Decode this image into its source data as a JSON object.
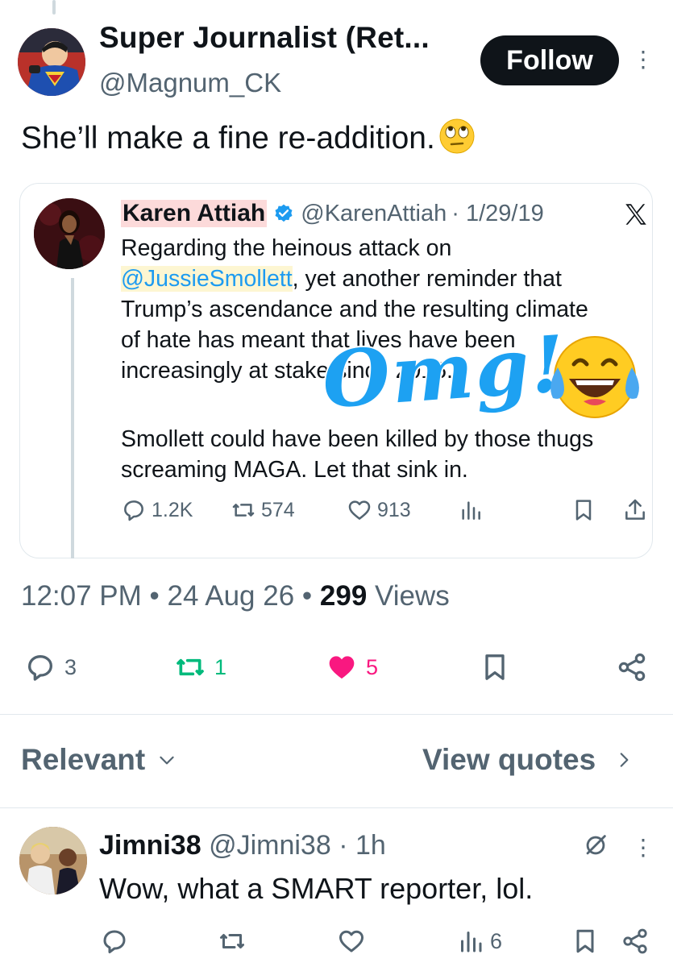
{
  "tweet": {
    "author_name": "Super Journalist (Ret...",
    "author_handle": "@Magnum_CK",
    "follow_label": "Follow",
    "text": "She’ll make a fine re-addition.",
    "timestamp": "12:07 PM • 24 Aug 26 •",
    "views_count": "299",
    "views_label": "Views",
    "replies": "3",
    "retweets": "1",
    "likes": "5"
  },
  "quote": {
    "author_name": "Karen Attiah",
    "author_handle": "@KarenAttiah",
    "date": "· 1/29/19",
    "mention": "@JussieSmollett",
    "line1": "Regarding the heinous attack on",
    "line2_rest": ", yet another reminder that",
    "line3": "Trump’s ascendance and the resulting climate",
    "line4": "of hate has meant that lives have been",
    "line5": "increasingly at stake since 2015.",
    "line6": "Smollett could have been killed by those thugs",
    "line7": "screaming MAGA. Let that sink in.",
    "replies": "1.2K",
    "retweets": "574",
    "likes": "913"
  },
  "overlay": {
    "text": "Omg!"
  },
  "replies_section": {
    "sort_label": "Relevant",
    "quotes_label": "View quotes"
  },
  "reply": {
    "name": "Jimni38",
    "handle": "@Jimni38",
    "time": "· 1h",
    "text": "Wow, what a SMART reporter, lol.",
    "views": "6"
  },
  "colors": {
    "like_pink": "#f91880",
    "retweet_green": "#00ba7c",
    "link_blue": "#1d9bf0",
    "muted_gray": "#536471"
  }
}
